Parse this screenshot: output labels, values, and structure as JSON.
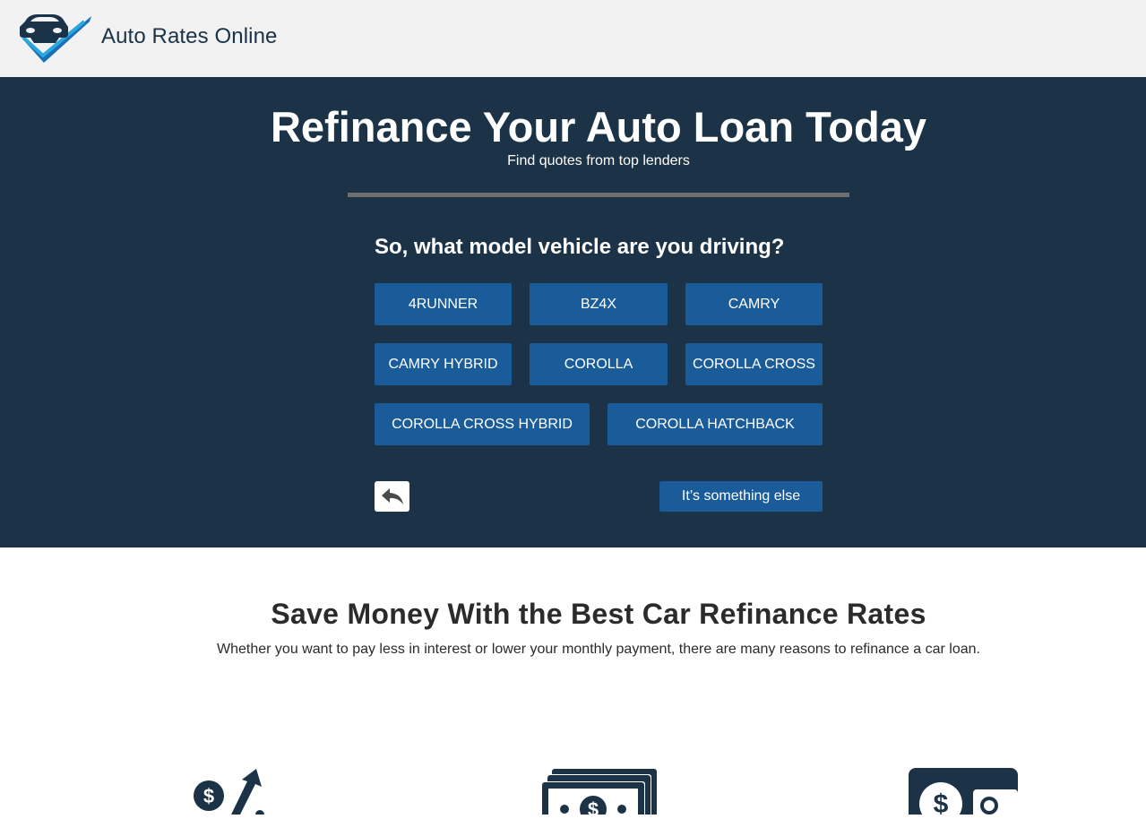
{
  "header": {
    "brand": "Auto Rates Online",
    "logo_icon": "car-checkmark-logo-icon"
  },
  "hero": {
    "title": "Refinance Your Auto Loan Today",
    "subtitle": "Find quotes from top lenders",
    "question": "So, what model vehicle are you driving?",
    "options": [
      "4RUNNER",
      "BZ4X",
      "CAMRY",
      "CAMRY HYBRID",
      "COROLLA",
      "COROLLA CROSS",
      "COROLLA CROSS HYBRID",
      "COROLLA HATCHBACK"
    ],
    "back_icon": "reply-arrow-icon",
    "something_else": "It’s something else"
  },
  "savings": {
    "title": "Save Money With the Best Car Refinance Rates",
    "subtitle": "Whether you want to pay less in interest or lower your monthly payment, there are many reasons to refinance a car loan.",
    "icons": [
      "dollar-arrow-up-icon",
      "cash-stack-icon",
      "dollar-card-icon"
    ]
  },
  "colors": {
    "hero_bg": "#1c3347",
    "button_bg": "#1a5b9a",
    "header_bg": "#f2f2f2"
  }
}
